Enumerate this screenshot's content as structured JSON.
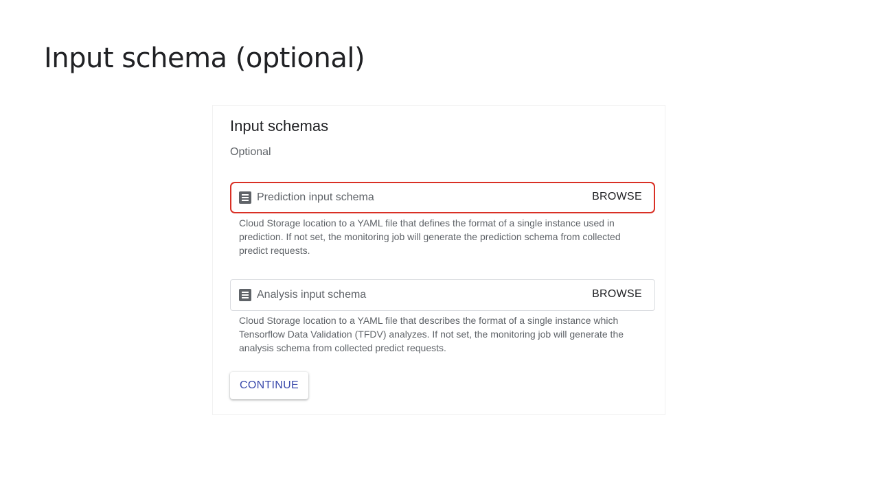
{
  "slide": {
    "title": "Input schema (optional)"
  },
  "card": {
    "title": "Input schemas",
    "subtitle": "Optional",
    "fields": [
      {
        "placeholder": "Prediction input schema",
        "action_label": "BROWSE",
        "icon": "document-icon",
        "highlighted": true,
        "helper_text": "Cloud Storage location to a YAML file that defines the format of a single instance used in prediction. If not set, the monitoring job will generate the prediction schema from collected predict requests."
      },
      {
        "placeholder": "Analysis input schema",
        "action_label": "BROWSE",
        "icon": "document-icon",
        "highlighted": false,
        "helper_text": "Cloud Storage location to a YAML file that describes the format of a single instance which Tensorflow Data Validation (TFDV) analyzes. If not set, the monitoring job will generate the analysis schema from collected predict requests."
      }
    ],
    "continue_label": "CONTINUE"
  },
  "colors": {
    "highlight_border": "#d93025",
    "primary_button_text": "#3949ab",
    "secondary_text": "#5f6368"
  }
}
